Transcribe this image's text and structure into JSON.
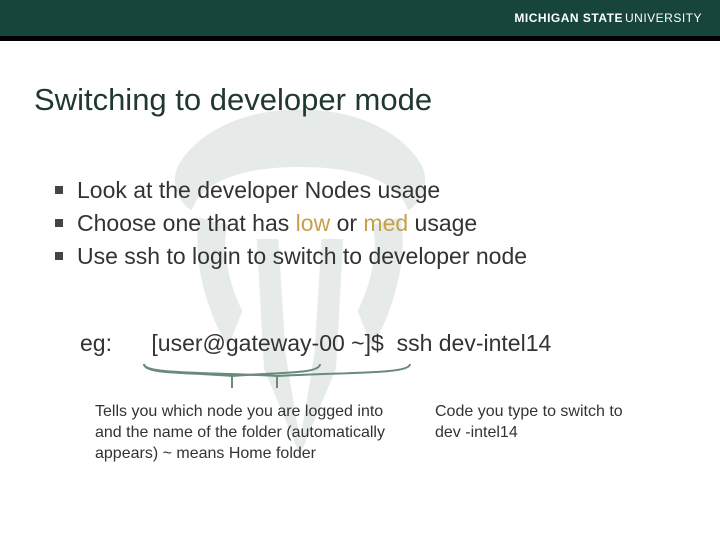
{
  "brand": {
    "part1": "MICHIGAN STATE",
    "part2": "UNIVERSITY"
  },
  "title": "Switching to developer mode",
  "bullets": [
    {
      "pre": "Look at the developer Nodes usage",
      "low": "",
      "mid": "",
      "med": "",
      "post": ""
    },
    {
      "pre": "Choose one that has ",
      "low": "low",
      "mid": " or ",
      "med": "med",
      "post": " usage"
    },
    {
      "pre": "Use ssh to login to switch to developer node",
      "low": "",
      "mid": "",
      "med": "",
      "post": ""
    }
  ],
  "example": {
    "label": "eg:",
    "prompt": "[user@gateway-00 ~]$",
    "command": "ssh dev-intel14"
  },
  "notes": {
    "left": "Tells you which node you are logged into and the name of the folder (automatically appears) ~ means Home folder",
    "right": "Code you type to switch to dev -intel14"
  }
}
